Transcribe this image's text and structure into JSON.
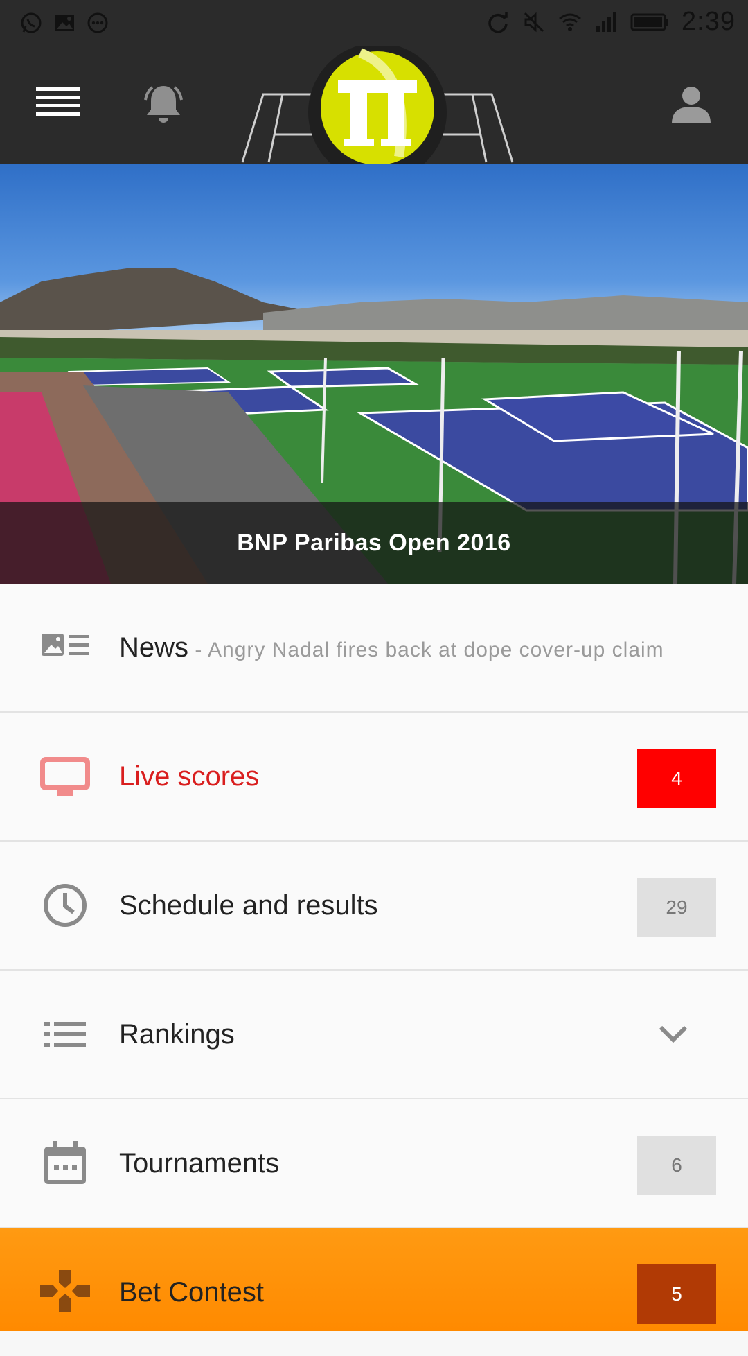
{
  "status_bar": {
    "left_icons": [
      "whatsapp-icon",
      "image-icon",
      "more-circle-icon"
    ],
    "right_icons": [
      "sync-icon",
      "mute-icon",
      "wifi-icon",
      "signal-icon",
      "battery-icon"
    ],
    "time": "2:39"
  },
  "app_bar": {
    "menu_icon": "hamburger-icon",
    "notifications_icon": "bell-icon",
    "logo_icon": "tennis-ball-logo",
    "profile_icon": "person-icon"
  },
  "hero": {
    "title": "BNP Paribas Open 2016"
  },
  "menu": {
    "news": {
      "label": "News",
      "subtitle": " - Angry Nadal fires back at dope cover-up claim",
      "icon": "news-icon"
    },
    "live_scores": {
      "label": "Live scores",
      "count": "4",
      "icon": "tv-icon"
    },
    "schedule": {
      "label": "Schedule and results",
      "count": "29",
      "icon": "clock-icon"
    },
    "rankings": {
      "label": "Rankings",
      "icon": "list-icon",
      "expand_icon": "chevron-down-icon"
    },
    "tournaments": {
      "label": "Tournaments",
      "count": "6",
      "icon": "calendar-icon"
    },
    "bet_contest": {
      "label": "Bet Contest",
      "count": "5",
      "icon": "gamepad-icon"
    }
  },
  "colors": {
    "live_accent": "#ff0000",
    "bet_background": "#ff8a00",
    "bet_badge": "#b13a05",
    "header_background": "#2b2b2b",
    "logo_yellow": "#d7e000"
  }
}
